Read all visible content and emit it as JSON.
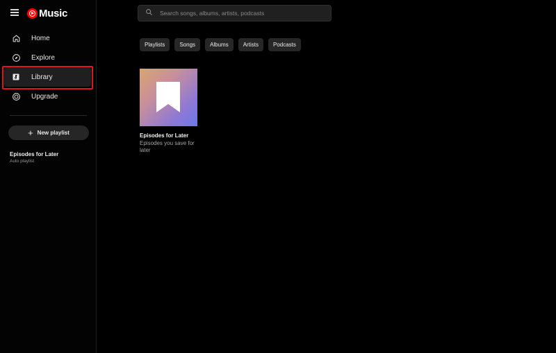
{
  "app": {
    "logo_text": "Music"
  },
  "sidebar": {
    "items": [
      {
        "label": "Home",
        "icon": "home-icon"
      },
      {
        "label": "Explore",
        "icon": "compass-icon"
      },
      {
        "label": "Library",
        "icon": "library-icon",
        "active": true
      },
      {
        "label": "Upgrade",
        "icon": "upgrade-icon"
      }
    ],
    "new_playlist_label": "New playlist",
    "playlists": [
      {
        "title": "Episodes for Later",
        "subtitle": "Auto playlist"
      }
    ]
  },
  "search": {
    "placeholder": "Search songs, albums, artists, podcasts"
  },
  "chips": [
    "Playlists",
    "Songs",
    "Albums",
    "Artists",
    "Podcasts"
  ],
  "cards": [
    {
      "title": "Episodes for Later",
      "subtitle": "Episodes you save for later",
      "icon": "bookmark-icon"
    }
  ],
  "colors": {
    "accent": "#ff0000",
    "highlight": "#e0141e",
    "background": "#000000"
  }
}
